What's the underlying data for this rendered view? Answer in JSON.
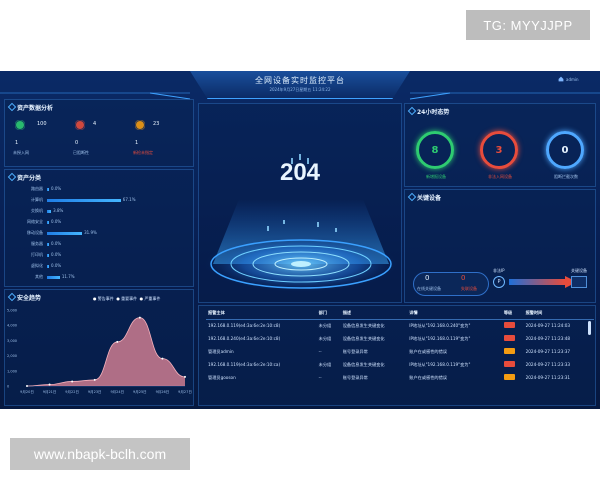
{
  "watermarks": {
    "top": "TG: MYYJJPP",
    "bottom": "www.nbapk-bclh.com"
  },
  "header": {
    "title": "全网设备实时监控平台",
    "datetime": "2024年9月27日星期五 11:24:22",
    "user": "admin"
  },
  "asset_data": {
    "title": "资产数据分析",
    "cards": [
      {
        "icon": "cube-icon",
        "count": "100",
        "sub": "1",
        "label": "未授入网",
        "color": "#2ecc71"
      },
      {
        "icon": "lock-icon",
        "count": "4",
        "sub": "0",
        "label": "已阻断性",
        "color": "#e74c3c"
      },
      {
        "icon": "warning-icon",
        "count": "23",
        "sub": "1",
        "label": "新检未指定",
        "color": "#f39c12"
      }
    ]
  },
  "asset_class": {
    "title": "资产分类",
    "rows": [
      {
        "label": "路由器",
        "value": 0.0,
        "text": "0.0%"
      },
      {
        "label": "计算机",
        "value": 67.1,
        "text": "67.1%"
      },
      {
        "label": "交换机",
        "value": 3.8,
        "text": "3.8%"
      },
      {
        "label": "网络安全",
        "value": 0.0,
        "text": "0.0%"
      },
      {
        "label": "移动设备",
        "value": 31.9,
        "text": "31.9%"
      },
      {
        "label": "服务器",
        "value": 0.0,
        "text": "0.0%"
      },
      {
        "label": "打印机",
        "value": 0.0,
        "text": "0.0%"
      },
      {
        "label": "虚拟化",
        "value": 0.0,
        "text": "0.0%"
      },
      {
        "label": "其他",
        "value": 11.7,
        "text": "11.7%"
      }
    ]
  },
  "security": {
    "title": "安全趋势",
    "legend": [
      "警告事件",
      "重要事件",
      "严重事件"
    ],
    "yticks": [
      "5,000",
      "4,000",
      "3,000",
      "2,000",
      "1,000",
      "0"
    ],
    "x": [
      "9月20日",
      "9月21日",
      "9月22日",
      "9月23日",
      "9月24日",
      "9月25日",
      "9月26日",
      "9月27日"
    ]
  },
  "chart_data": {
    "type": "area",
    "title": "安全趋势",
    "categories": [
      "9月20日",
      "9月21日",
      "9月22日",
      "9月23日",
      "9月24日",
      "9月25日",
      "9月26日",
      "9月27日"
    ],
    "series": [
      {
        "name": "严重事件",
        "values": [
          0,
          100,
          300,
          400,
          2900,
          4500,
          1800,
          600
        ]
      }
    ],
    "ylim": [
      0,
      5000
    ],
    "legend": "top-right",
    "grid": false
  },
  "center": {
    "value": "204"
  },
  "trend24": {
    "title": "24小时态势",
    "items": [
      {
        "value": "8",
        "label": "新增报设备",
        "color": "#2ecc71"
      },
      {
        "value": "3",
        "label": "非法入网设备",
        "color": "#e74c3c"
      },
      {
        "value": "0",
        "label": "阻断拦截次数",
        "color": "#cfe3ff"
      }
    ]
  },
  "key_devices": {
    "title": "关键设备",
    "online": {
      "value": "0",
      "label": "在线关键设备"
    },
    "offline": {
      "value": "0",
      "label": "失联设备"
    },
    "ip_label": "非法IP",
    "right_label": "关键设备"
  },
  "events": {
    "headers": [
      "报警主体",
      "部门",
      "描述",
      "详情",
      "等级",
      "报警时间"
    ],
    "rows": [
      {
        "subject": "192.168.0.119(e4:3a:6e:2e:10:c8)",
        "dept": "未分组",
        "desc": "设备信息发生关键变化",
        "detail": "IP地址从\"192.168.0.240\"变为\"",
        "level": "#e74c3c",
        "time": "2024-09-27 11:24:03"
      },
      {
        "subject": "192.168.0.240(e4:3a:6e:2e:10:c8)",
        "dept": "未分组",
        "desc": "设备信息发生关键变化",
        "detail": "IP地址从\"192.168.0.119\"变为\"",
        "level": "#e74c3c",
        "time": "2024-09-27 11:23:48"
      },
      {
        "subject": "管理员admin",
        "dept": "--",
        "desc": "账号登录异常",
        "detail": "账户在或感性的错误",
        "level": "#f39c12",
        "time": "2024-09-27 11:23:37"
      },
      {
        "subject": "192.168.0.119(e4:3a:6e:2e:10:ca)",
        "dept": "未分组",
        "desc": "设备信息发生关键变化",
        "detail": "IP地址从\"192.168.0.119\"变为\"",
        "level": "#e74c3c",
        "time": "2024-09-27 11:23:33"
      },
      {
        "subject": "管理员gooson",
        "dept": "--",
        "desc": "账号登录异常",
        "detail": "账户在或感性的错误",
        "level": "#f39c12",
        "time": "2024-09-27 11:23:31"
      }
    ]
  }
}
